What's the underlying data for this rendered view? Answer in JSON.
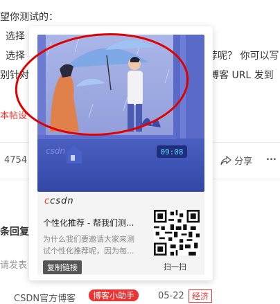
{
  "background": {
    "line1": "望你测试的：",
    "line2": "选择",
    "line3_left": "选择",
    "line3_right": "荐呢？ 你可以写",
    "line4_left": "别针对",
    "line4_right": "博客 URL 发到",
    "notice": "本帖设",
    "count": "4754",
    "share_label": "分享",
    "more_label": "...",
    "reply_header": "条回复",
    "reply_placeholder": "请发表",
    "bottom_author": "CSDN官方博客",
    "bottom_badge": "博客小助手",
    "bottom_date": "05-22",
    "bottom_tag": "经济"
  },
  "card": {
    "brand": "csdn",
    "illustration_clock": "09:08",
    "illustration_watermark": "csdn",
    "title": "个性化推荐 - 帮我们测...",
    "description": "为什么我们要邀请大家来测试个性化推荐呢，因为每...",
    "copy_link": "复制链接",
    "scan": "扫一扫"
  },
  "colors": {
    "accent_red": "#e33333",
    "highlight_ellipse": "#e00000"
  }
}
